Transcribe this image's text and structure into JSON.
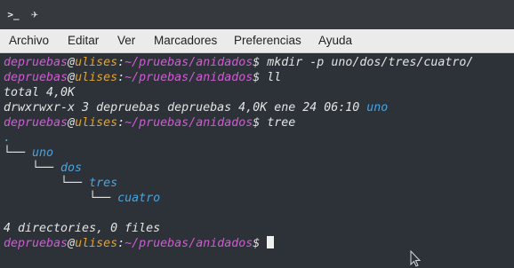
{
  "titlebar": {
    "terminal_icon": "terminal-icon",
    "pin_icon": "pin-icon",
    "terminal_glyph": ">_",
    "pin_glyph": "✈"
  },
  "menu": [
    "Archivo",
    "Editar",
    "Ver",
    "Marcadores",
    "Preferencias",
    "Ayuda"
  ],
  "prompt": {
    "user": "depruebas",
    "at": "@",
    "host": "ulises",
    "colon": ":",
    "path": "~/pruebas/anidados",
    "symbol": "$"
  },
  "commands": {
    "c1": " mkdir -p uno/dos/tres/cuatro/",
    "c2": " ll",
    "c3": " tree"
  },
  "output": {
    "total": "total 4,0K",
    "ls_line": "drwxrwxr-x 3 depruebas depruebas 4,0K ene 24 06:10 ",
    "ls_name": "uno",
    "tree_root": ".",
    "tree_l1_prefix": "└── ",
    "tree_l1": "uno",
    "tree_l2_prefix": "    └── ",
    "tree_l2": "dos",
    "tree_l3_prefix": "        └── ",
    "tree_l3": "tres",
    "tree_l4_prefix": "            └── ",
    "tree_l4": "cuatro",
    "summary": "4 directories, 0 files"
  },
  "colors": {
    "background": "#2d3238",
    "user": "#d05cd4",
    "host": "#e3a32e",
    "directory": "#4aa4e0"
  }
}
